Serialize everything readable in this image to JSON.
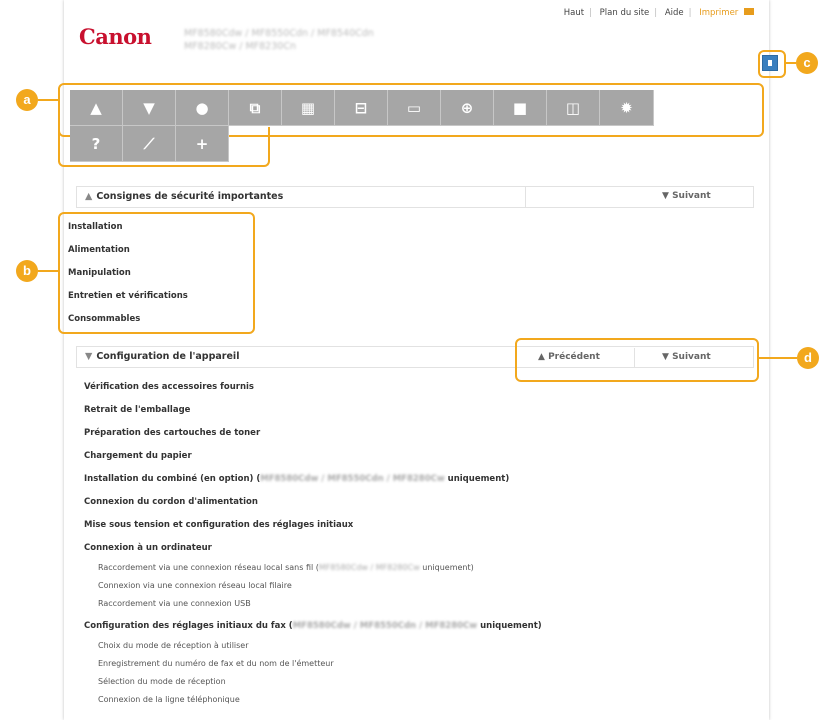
{
  "header": {
    "nav": [
      "Haut",
      "Plan du site",
      "Aide",
      "Imprimer"
    ],
    "logo": "Canon",
    "model_line1": "MF8580Cdw / MF8550Cdn / MF8540Cdn",
    "model_line2": "MF8280Cw / MF8230Cn"
  },
  "callouts": [
    "a",
    "b",
    "c",
    "d"
  ],
  "icons_row1": [
    "warning-icon",
    "tshirt-icon",
    "hand-icon",
    "copy-icon",
    "fax-icon",
    "print-icon",
    "scan-icon",
    "network-icon",
    "lock-icon",
    "screen-icon",
    "gear-icon"
  ],
  "icons_row2": [
    "help-icon",
    "wrench-icon",
    "plus-icon"
  ],
  "section1": {
    "title": "Consignes de sécurité importantes",
    "next": "Suivant",
    "items": [
      "Installation",
      "Alimentation",
      "Manipulation",
      "Entretien et vérifications",
      "Consommables"
    ]
  },
  "section2": {
    "title": "Configuration de l'appareil",
    "prev": "Précédent",
    "next": "Suivant",
    "items": [
      "Vérification des accessoires fournis",
      "Retrait de l'emballage",
      "Préparation des cartouches de toner",
      "Chargement du papier"
    ],
    "handset_a": "Installation du combiné (en option) (",
    "handset_models": "MF8580Cdw / MF8550Cdn / MF8280Cw",
    "handset_b": " uniquement)",
    "items2": [
      "Connexion du cordon d'alimentation",
      "Mise sous tension et configuration des réglages initiaux",
      "Connexion à un ordinateur"
    ],
    "sub1a": "Raccordement via une connexion réseau local sans fil (",
    "sub1_models": "MF8580Cdw / MF8280Cw",
    "sub1b": " uniquement)",
    "sub2": "Connexion via une connexion réseau local filaire",
    "sub3": "Raccordement via une connexion USB",
    "fax_a": "Configuration des réglages initiaux du fax (",
    "fax_models": "MF8580Cdw / MF8550Cdn / MF8280Cw",
    "fax_b": " uniquement)",
    "fax_subs": [
      "Choix du mode de réception à utiliser",
      "Enregistrement du numéro de fax et du nom de l'émetteur",
      "Sélection du mode de réception",
      "Connexion de la ligne téléphonique"
    ]
  }
}
